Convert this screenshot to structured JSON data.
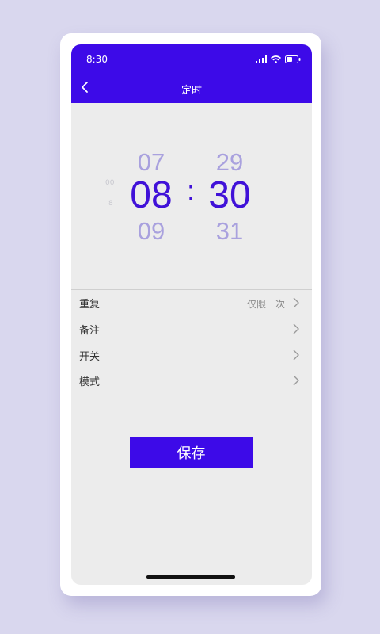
{
  "status_bar": {
    "time": "8:30"
  },
  "header": {
    "title": "定时"
  },
  "time_picker": {
    "hour_prev": "07",
    "hour_selected": "08",
    "hour_next": "09",
    "minute_prev": "29",
    "minute_selected": "30",
    "minute_next": "31",
    "separator": ":"
  },
  "settings": {
    "rows": [
      {
        "label": "重复",
        "value": "仅限一次"
      },
      {
        "label": "备注",
        "value": ""
      },
      {
        "label": "开关",
        "value": ""
      },
      {
        "label": "模式",
        "value": ""
      }
    ]
  },
  "actions": {
    "save_label": "保存"
  },
  "colors": {
    "accent": "#3d0ae8",
    "background": "#ececec",
    "outer": "#d9d7ee"
  }
}
